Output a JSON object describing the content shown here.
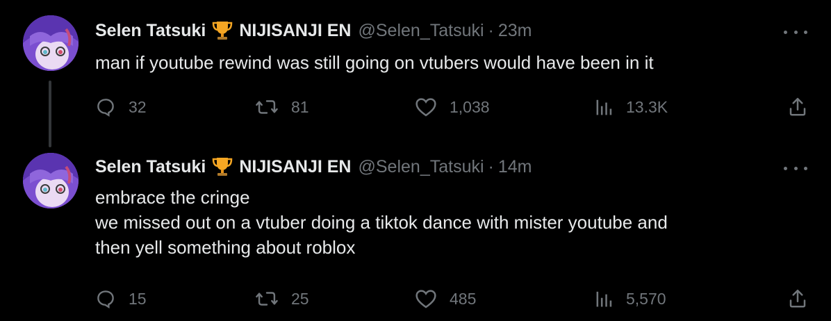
{
  "tweets": [
    {
      "display_name": "Selen Tatsuki",
      "badge_icon": "trophy-icon",
      "affiliation": "NIJISANJI EN",
      "handle": "@Selen_Tatsuki",
      "separator": "·",
      "time": "23m",
      "text_lines": [
        "man if youtube rewind was still going on vtubers would have been in it"
      ],
      "replies": "32",
      "retweets": "81",
      "likes": "1,038",
      "views": "13.3K"
    },
    {
      "display_name": "Selen Tatsuki",
      "badge_icon": "trophy-icon",
      "affiliation": "NIJISANJI EN",
      "handle": "@Selen_Tatsuki",
      "separator": "·",
      "time": "14m",
      "text_lines": [
        "embrace the cringe",
        "we missed out on a vtuber doing a tiktok dance with mister youtube and",
        "then yell something about roblox"
      ],
      "replies": "15",
      "retweets": "25",
      "likes": "485",
      "views": "5,570"
    }
  ],
  "colors": {
    "background": "#000000",
    "primary_text": "#e7e9ea",
    "secondary_text": "#71767b",
    "thread_line": "#333639",
    "badge_gold": "#f5a623"
  },
  "icons": {
    "reply": "reply-icon",
    "retweet": "retweet-icon",
    "like": "heart-icon",
    "views": "views-icon",
    "share": "share-icon",
    "more": "more-icon"
  }
}
